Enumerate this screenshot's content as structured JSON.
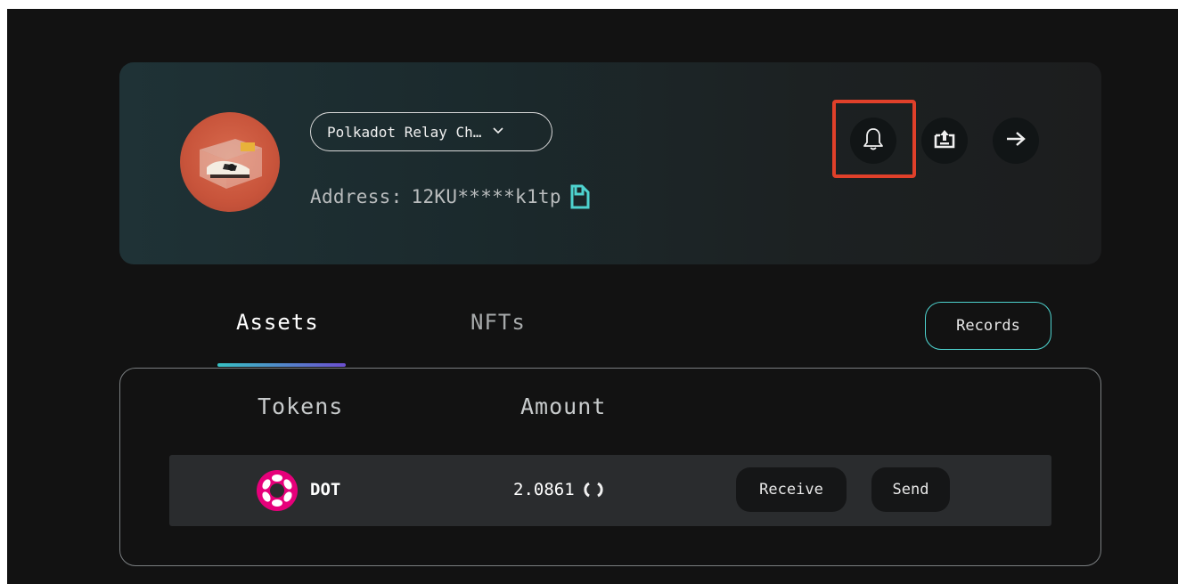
{
  "account": {
    "chain_selector": "Polkadot Relay Ch…",
    "address_label": "Address:",
    "address_value": "12KU*****k1tp",
    "icons": [
      "avatar-nft-image",
      "chevron-down-icon",
      "copy-icon",
      "bell-icon",
      "upload-icon",
      "arrow-right-icon"
    ]
  },
  "tabs": [
    {
      "label": "Assets",
      "active": true
    },
    {
      "label": "NFTs",
      "active": false
    }
  ],
  "records_label": "Records",
  "assets": {
    "columns": [
      "Tokens",
      "Amount"
    ],
    "rows": [
      {
        "token": "DOT",
        "amount": "2.0861",
        "actions": [
          "Receive",
          "Send"
        ]
      }
    ]
  },
  "colors": {
    "accent": "#4ed3cf",
    "highlight": "#e0402a",
    "polkadot": "#e6007a"
  }
}
